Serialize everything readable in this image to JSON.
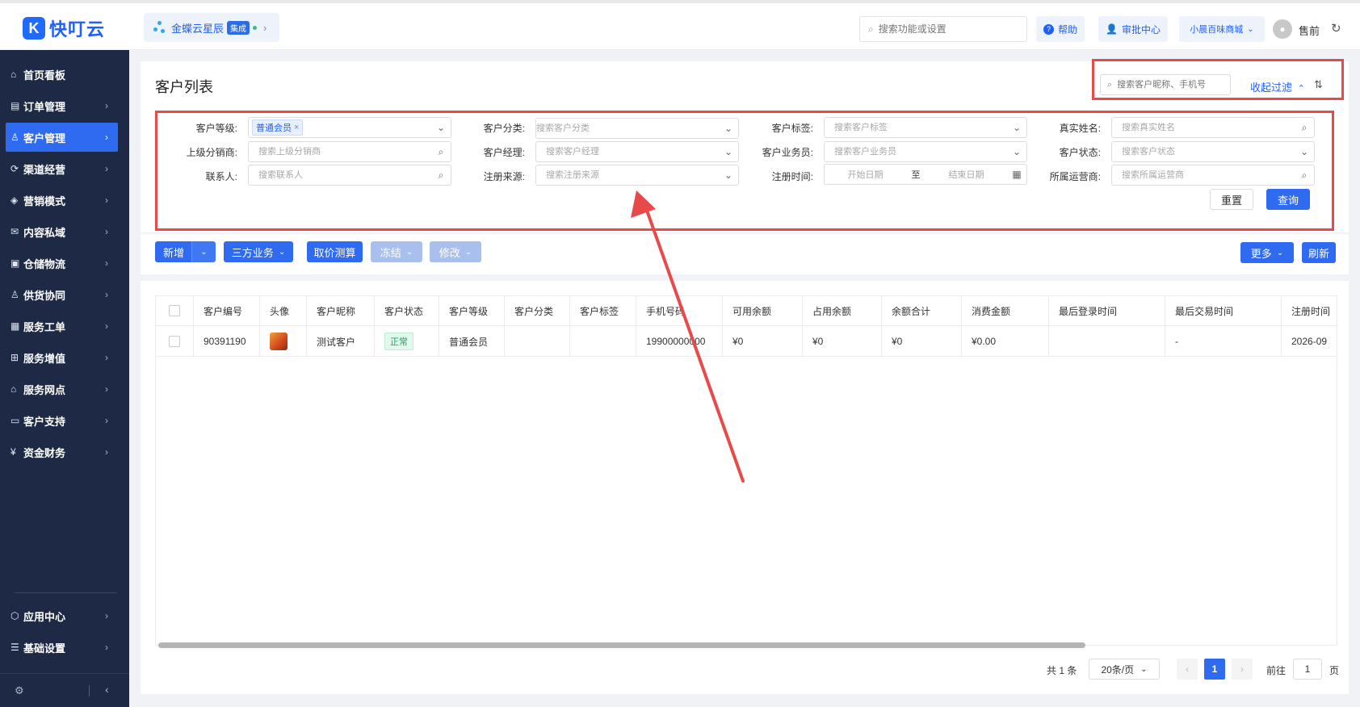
{
  "brand": {
    "logo_letter": "K",
    "name": "快叮云"
  },
  "app_switch": {
    "name": "金蝶云星辰",
    "badge": "集成"
  },
  "top": {
    "search_placeholder": "搜索功能或设置",
    "help_label": "帮助",
    "approval_label": "审批中心",
    "shop_label": "小晨百味商城",
    "user_name": "售前"
  },
  "sidebar": {
    "items": [
      {
        "label": "首页看板",
        "icon": "⌂"
      },
      {
        "label": "订单管理",
        "icon": "▤"
      },
      {
        "label": "客户管理",
        "icon": "♙"
      },
      {
        "label": "渠道经营",
        "icon": "⟳"
      },
      {
        "label": "营销模式",
        "icon": "◈"
      },
      {
        "label": "内容私域",
        "icon": "✉"
      },
      {
        "label": "仓储物流",
        "icon": "▣"
      },
      {
        "label": "供货协同",
        "icon": "♙"
      },
      {
        "label": "服务工单",
        "icon": "▦"
      },
      {
        "label": "服务增值",
        "icon": "⊞"
      },
      {
        "label": "服务网点",
        "icon": "⌂"
      },
      {
        "label": "客户支持",
        "icon": "▭"
      },
      {
        "label": "资金财务",
        "icon": "¥"
      }
    ],
    "bottom_items": [
      {
        "label": "应用中心",
        "icon": "⬡"
      },
      {
        "label": "基础设置",
        "icon": "☰"
      }
    ]
  },
  "page": {
    "title": "客户列表",
    "header_search_placeholder": "搜索客户昵称、手机号",
    "collapse_filter": "收起过滤"
  },
  "filters": {
    "level_label": "客户等级:",
    "level_tag": "普通会员",
    "category_label": "客户分类:",
    "category_placeholder": "搜索客户分类",
    "tag_label": "客户标签:",
    "tag_placeholder": "搜索客户标签",
    "realname_label": "真实姓名:",
    "realname_placeholder": "搜索真实姓名",
    "distributor_label": "上级分销商:",
    "distributor_placeholder": "搜索上级分销商",
    "manager_label": "客户经理:",
    "manager_placeholder": "搜索客户经理",
    "salesman_label": "客户业务员:",
    "salesman_placeholder": "搜索客户业务员",
    "status_label": "客户状态:",
    "status_placeholder": "搜索客户状态",
    "contact_label": "联系人:",
    "contact_placeholder": "搜索联系人",
    "source_label": "注册来源:",
    "source_placeholder": "搜索注册来源",
    "regtime_label": "注册时间:",
    "start_date": "开始日期",
    "to": "至",
    "end_date": "结束日期",
    "operator_label": "所属运营商:",
    "operator_placeholder": "搜索所属运营商",
    "reset": "重置",
    "query": "查询"
  },
  "toolbar": {
    "add": "新增",
    "third_party": "三方业务",
    "price_calc": "取价测算",
    "freeze": "冻结",
    "modify": "修改",
    "more": "更多",
    "refresh": "刷新"
  },
  "table": {
    "headers": [
      "客户编号",
      "头像",
      "客户昵称",
      "客户状态",
      "客户等级",
      "客户分类",
      "客户标签",
      "手机号码",
      "可用余额",
      "占用余额",
      "余额合计",
      "消费金额",
      "最后登录时间",
      "最后交易时间",
      "注册时间"
    ],
    "rows": [
      {
        "id": "90391190",
        "nickname": "测试客户",
        "status": "正常",
        "level": "普通会员",
        "category": "",
        "tag": "",
        "phone": "19900000000",
        "available": "¥0",
        "occupied": "¥0",
        "total": "¥0",
        "spent": "¥0.00",
        "last_login": "",
        "last_trade": "-",
        "reg_time": "2026-09"
      }
    ]
  },
  "pager": {
    "total": "共 1 条",
    "page_size": "20条/页",
    "current": "1",
    "goto_label": "前往",
    "goto_value": "1",
    "page_unit": "页"
  },
  "colors": {
    "accent": "#2f6bf0",
    "sidebar_bg": "#1e2a45",
    "highlight": "#e84a4a"
  }
}
